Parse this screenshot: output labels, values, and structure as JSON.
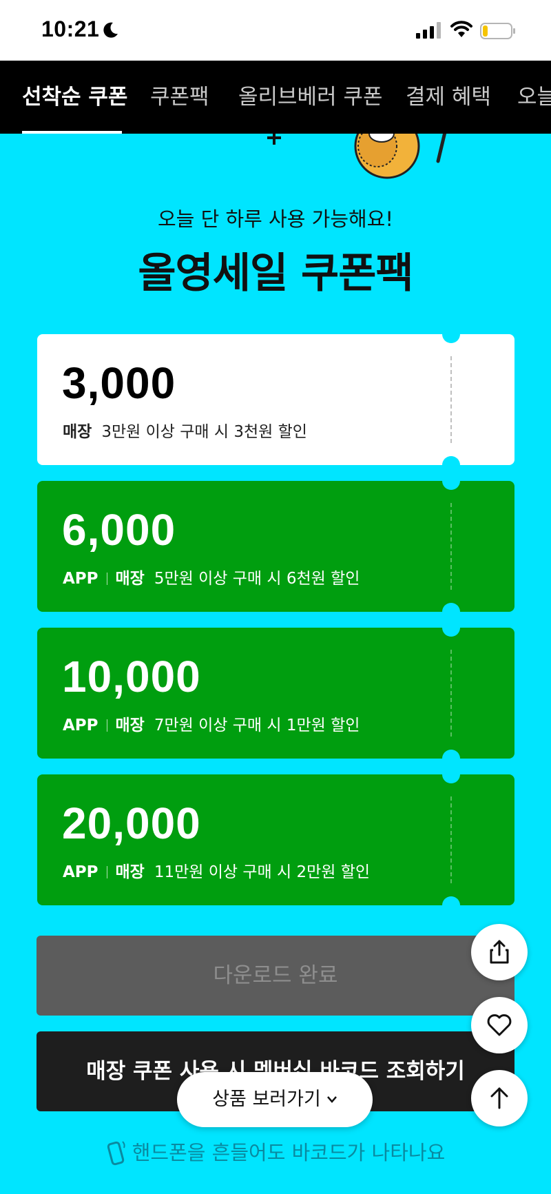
{
  "status_bar": {
    "time": "10:21"
  },
  "tabs": [
    {
      "label": "선착순 쿠폰"
    },
    {
      "label": "쿠폰팩"
    },
    {
      "label": "올리브베러 쿠폰"
    },
    {
      "label": "결제 혜택"
    },
    {
      "label": "오늘"
    }
  ],
  "promo": {
    "subtitle": "오늘 단 하루 사용 가능해요!",
    "title": "올영세일 쿠폰팩"
  },
  "coupons": [
    {
      "amount": "3,000",
      "tags": [
        "매장"
      ],
      "description": "3만원 이상 구매 시 3천원 할인",
      "style": "white"
    },
    {
      "amount": "6,000",
      "tags": [
        "APP",
        "매장"
      ],
      "description": "5만원 이상 구매 시 6천원 할인",
      "style": "green"
    },
    {
      "amount": "10,000",
      "tags": [
        "APP",
        "매장"
      ],
      "description": "7만원 이상 구매 시 1만원 할인",
      "style": "green"
    },
    {
      "amount": "20,000",
      "tags": [
        "APP",
        "매장"
      ],
      "description": "11만원 이상 구매 시 2만원 할인",
      "style": "green"
    }
  ],
  "buttons": {
    "download": "다운로드 완료",
    "barcode": "매장 쿠폰 사용 시 멤버십 바코드 조회하기",
    "shake_hint": "핸드폰을 흔들어도 바코드가 나타나요",
    "product": "상품 보러가기"
  },
  "colors": {
    "background": "#00e5ff",
    "coupon_green": "#009e0f",
    "tab_bar": "#000000"
  },
  "icons": {
    "share": "share-icon",
    "like": "heart-icon",
    "top": "arrow-up-icon"
  }
}
